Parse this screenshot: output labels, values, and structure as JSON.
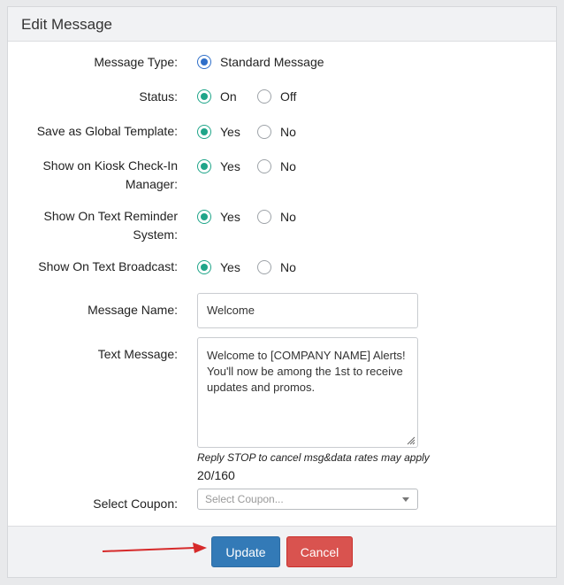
{
  "panel": {
    "title": "Edit Message"
  },
  "form": {
    "message_type": {
      "label": "Message Type:",
      "options": [
        "Standard Message"
      ],
      "selected": "Standard Message"
    },
    "status": {
      "label": "Status:",
      "options": [
        "On",
        "Off"
      ],
      "selected": "On"
    },
    "global_template": {
      "label": "Save as Global Template:",
      "options": [
        "Yes",
        "No"
      ],
      "selected": "Yes"
    },
    "kiosk": {
      "label_line1": "Show on Kiosk Check-In",
      "label_line2": "Manager:",
      "options": [
        "Yes",
        "No"
      ],
      "selected": "Yes"
    },
    "text_reminder": {
      "label_line1": "Show On Text Reminder",
      "label_line2": "System:",
      "options": [
        "Yes",
        "No"
      ],
      "selected": "Yes"
    },
    "text_broadcast": {
      "label": "Show On Text Broadcast:",
      "options": [
        "Yes",
        "No"
      ],
      "selected": "Yes"
    },
    "message_name": {
      "label": "Message Name:",
      "value": "Welcome"
    },
    "text_message": {
      "label": "Text Message:",
      "value": "Welcome to [COMPANY NAME] Alerts!\nYou'll now be among the 1st to receive\nupdates and promos.",
      "helper": "Reply STOP to cancel msg&data rates may apply",
      "counter": "20/160"
    },
    "coupon": {
      "label": "Select Coupon:",
      "placeholder": "Select Coupon..."
    }
  },
  "footer": {
    "update_label": "Update",
    "cancel_label": "Cancel"
  },
  "colors": {
    "teal_radio": "#1fa589",
    "blue_radio": "#2f6fc9",
    "update_bg": "#337ab7",
    "cancel_bg": "#d9534f",
    "arrow": "#d62a2a"
  },
  "icons": [
    "resize-grip-icon",
    "chevron-down-icon",
    "red-arrow-icon"
  ]
}
